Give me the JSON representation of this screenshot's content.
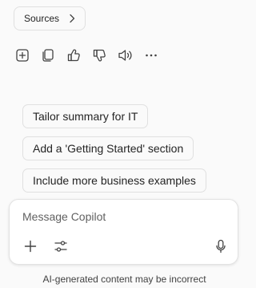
{
  "sources": {
    "label": "Sources",
    "icon": "chevron-right-icon"
  },
  "message_actions": [
    {
      "name": "add-to-page-button",
      "icon": "add-square-icon"
    },
    {
      "name": "copy-button",
      "icon": "copy-icon"
    },
    {
      "name": "like-button",
      "icon": "thumbs-up-icon"
    },
    {
      "name": "dislike-button",
      "icon": "thumbs-down-icon"
    },
    {
      "name": "read-aloud-button",
      "icon": "speaker-icon"
    },
    {
      "name": "more-options-button",
      "icon": "more-horizontal-icon"
    }
  ],
  "suggestions": [
    "Tailor summary for IT",
    "Add a 'Getting Started' section",
    "Include more business examples"
  ],
  "composer": {
    "placeholder": "Message Copilot",
    "add_icon": "plus-icon",
    "tools_icon": "options-sliders-icon",
    "mic_icon": "microphone-icon"
  },
  "disclaimer": "AI-generated content may be incorrect",
  "colors": {
    "background": "#fafafa",
    "border": "#e0e0e0",
    "text": "#242424",
    "muted_text": "#616161"
  }
}
